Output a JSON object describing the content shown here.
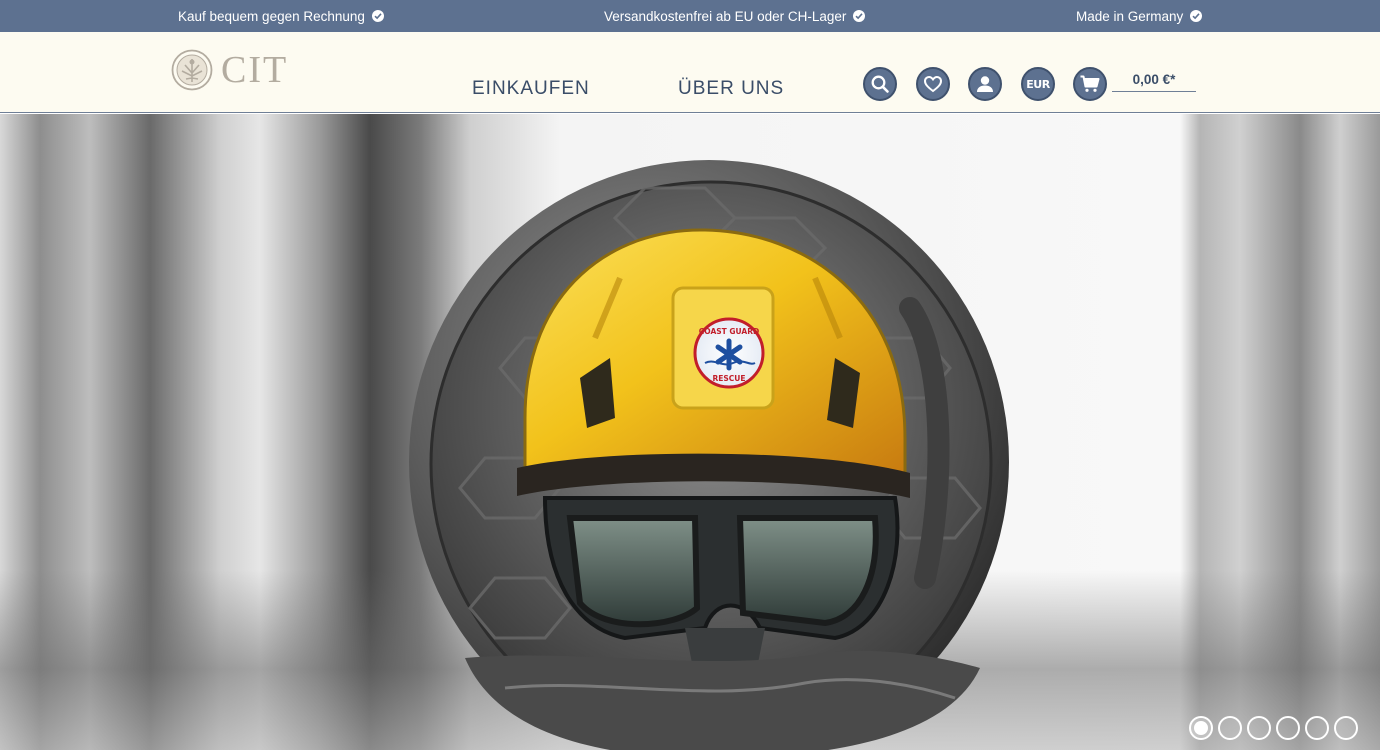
{
  "topbar": {
    "usps": [
      {
        "label": "Kauf bequem gegen Rechnung",
        "icon": "check-circle-icon"
      },
      {
        "label": "Versandkostenfrei ab EU oder CH-Lager",
        "icon": "check-circle-icon"
      },
      {
        "label": "Made in Germany",
        "icon": "check-circle-icon"
      }
    ]
  },
  "header": {
    "logo_text": "CIT",
    "nav": [
      {
        "label": "EINKAUFEN"
      },
      {
        "label": "ÜBER UNS"
      }
    ],
    "icons": [
      "search-icon",
      "heart-icon",
      "account-icon",
      "currency-icon",
      "cart-icon"
    ],
    "currency_label": "EUR",
    "cart_total": "0,00 €*"
  },
  "hero": {
    "slides": 6,
    "active_slide": 1,
    "coin_badge": {
      "top_text": "COAST GUARD",
      "bottom_text": "RESCUE"
    }
  },
  "colors": {
    "topbar_bg": "#5d7190",
    "header_bg": "#fdfbf1",
    "nav_text": "#3a4d68",
    "icon_bg": "#5d7190",
    "helmet_yellow": "#f2c21b"
  }
}
